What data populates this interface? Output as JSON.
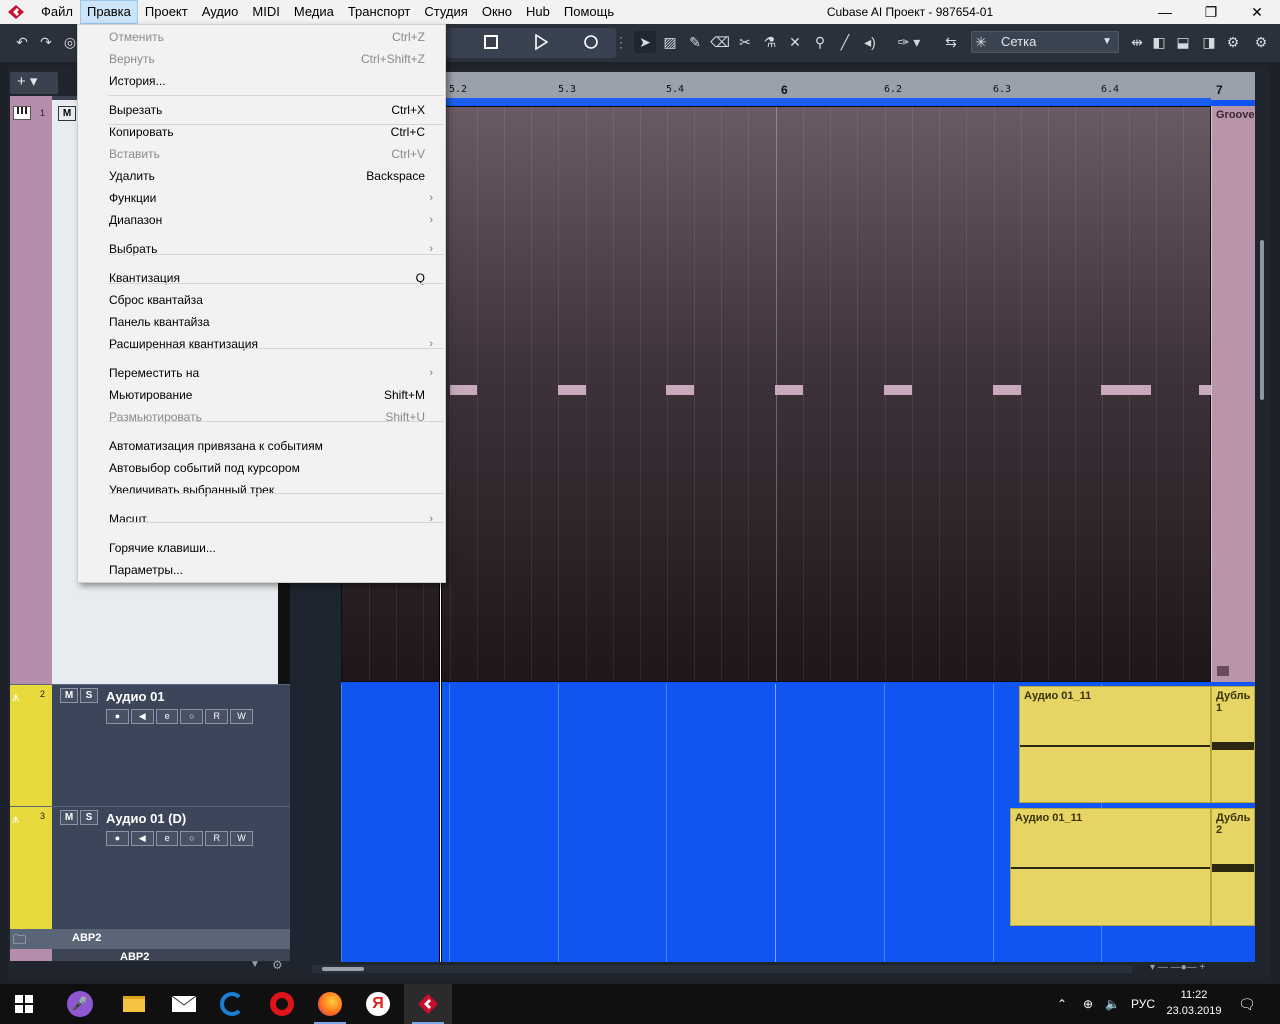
{
  "window": {
    "title": "Cubase AI Проект - 987654-01",
    "minimize": "—",
    "restore": "❐",
    "close": "✕"
  },
  "menubar": [
    "Файл",
    "Правка",
    "Проект",
    "Аудио",
    "MIDI",
    "Медиа",
    "Транспорт",
    "Студия",
    "Окно",
    "Hub",
    "Помощь"
  ],
  "menubar_active": "Правка",
  "toolbar": {
    "snap_value": "Сетка",
    "icons": [
      "undo-icon",
      "redo-icon",
      "stop-icon",
      "play-icon",
      "record-icon",
      "select-tool-icon",
      "range-tool-icon",
      "draw-tool-icon",
      "erase-tool-icon",
      "split-tool-icon",
      "glue-tool-icon",
      "mute-tool-icon",
      "zoom-tool-icon",
      "line-tool-icon",
      "play-tool-icon",
      "color-tool-icon",
      "snap-icon",
      "snap-mode-icon",
      "layout-icons"
    ]
  },
  "ruler": {
    "labels": [
      "5.2",
      "5.3",
      "5.4",
      "6",
      "6.2",
      "6.3",
      "6.4",
      "7"
    ]
  },
  "edit_menu": {
    "items": [
      {
        "label": "Отменить",
        "shortcut": "Ctrl+Z",
        "disabled": true
      },
      {
        "label": "Вернуть",
        "shortcut": "Ctrl+Shift+Z",
        "disabled": true
      },
      {
        "label": "История...",
        "shortcut": ""
      },
      {
        "label": "Вырезать",
        "shortcut": "Ctrl+X"
      },
      {
        "label": "Копировать",
        "shortcut": "Ctrl+C"
      },
      {
        "label": "Вставить",
        "shortcut": "Ctrl+V",
        "disabled": true
      },
      {
        "label": "Удалить",
        "shortcut": "Backspace"
      },
      {
        "label": "Функции",
        "submenu": true
      },
      {
        "label": "Диапазон",
        "submenu": true
      },
      {
        "label": "Выбрать",
        "submenu": true
      },
      {
        "label": "Квантизация",
        "shortcut": "Q"
      },
      {
        "label": "Сброс квантайза",
        "shortcut": ""
      },
      {
        "label": "Панель квантайза",
        "shortcut": ""
      },
      {
        "label": "Расширенная квантизация",
        "submenu": true
      },
      {
        "label": "Переместить на",
        "submenu": true
      },
      {
        "label": "Мьютирование",
        "shortcut": "Shift+M"
      },
      {
        "label": "Размьютировать",
        "shortcut": "Shift+U",
        "disabled": true
      },
      {
        "label": "Автоматизация привязана к событиям",
        "shortcut": ""
      },
      {
        "label": "Автовыбор событий под курсором",
        "shortcut": ""
      },
      {
        "label": "Увеличивать выбранный трек",
        "shortcut": ""
      },
      {
        "label": "Масшт.",
        "submenu": true
      },
      {
        "label": "Горячие клавиши...",
        "shortcut": ""
      },
      {
        "label": "Параметры...",
        "shortcut": ""
      }
    ]
  },
  "tracks": [
    {
      "num": "1",
      "mute": "M",
      "name": "",
      "type": "instrument"
    },
    {
      "num": "2",
      "mute": "M",
      "solo": "S",
      "name": "Аудио 01",
      "controls": [
        "●",
        "◀",
        "e",
        "○",
        "R",
        "W"
      ]
    },
    {
      "num": "3",
      "mute": "M",
      "solo": "S",
      "name": "Аудио 01 (D)",
      "controls": [
        "●",
        "◀",
        "e",
        "○",
        "R",
        "W"
      ]
    }
  ],
  "folder_track": {
    "name": "ABP2",
    "name2": "ABP2"
  },
  "events": [
    {
      "name": "Аудио 01_11"
    },
    {
      "name": "Дубль 1"
    },
    {
      "name": "Аудио 01_11"
    },
    {
      "name": "Дубль 2"
    }
  ],
  "groove_label": "Groove",
  "inspector_add": "+ ▾",
  "taskbar": {
    "lang": "РУС",
    "time": "11:22",
    "date": "23.03.2019"
  },
  "colors": {
    "track1": "#b58dab",
    "audio_track": "#e8d93c",
    "event": "#e6d565",
    "lane_blue": "#1055f1",
    "menu_active": "#cce4f7"
  }
}
